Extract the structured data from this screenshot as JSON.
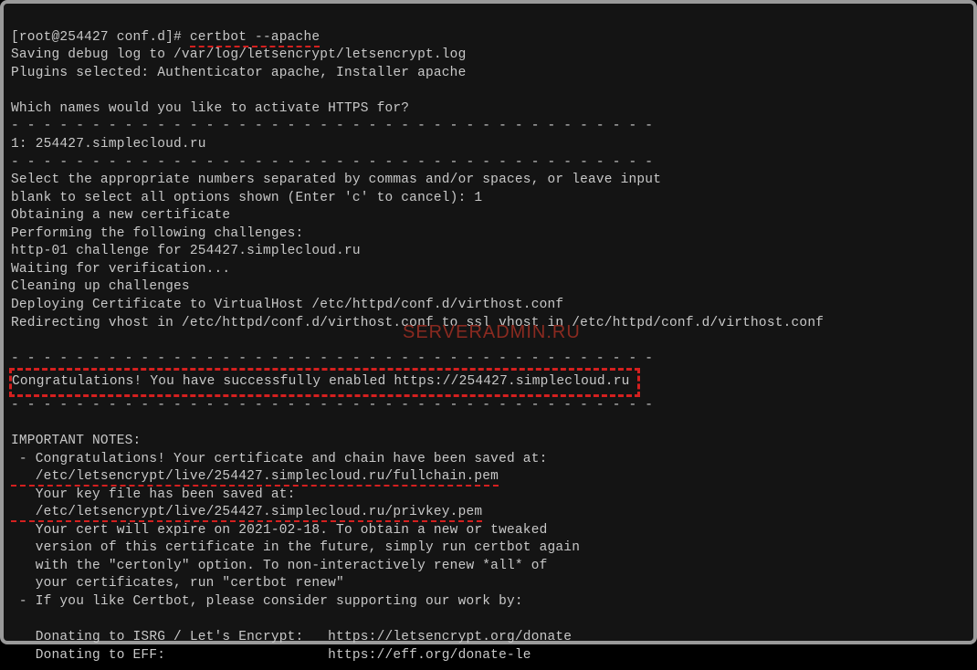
{
  "prompt": "[root@254427 conf.d]# ",
  "command": "certbot --apache",
  "lines": {
    "l1": "Saving debug log to /var/log/letsencrypt/letsencrypt.log",
    "l2": "Plugins selected: Authenticator apache, Installer apache",
    "l3": "",
    "l4": "Which names would you like to activate HTTPS for?",
    "l5": "- - - - - - - - - - - - - - - - - - - - - - - - - - - - - - - - - - - - - - - -",
    "l6": "1: 254427.simplecloud.ru",
    "l7": "- - - - - - - - - - - - - - - - - - - - - - - - - - - - - - - - - - - - - - - -",
    "l8": "Select the appropriate numbers separated by commas and/or spaces, or leave input",
    "l9": "blank to select all options shown (Enter 'c' to cancel): 1",
    "l10": "Obtaining a new certificate",
    "l11": "Performing the following challenges:",
    "l12": "http-01 challenge for 254427.simplecloud.ru",
    "l13": "Waiting for verification...",
    "l14": "Cleaning up challenges",
    "l15": "Deploying Certificate to VirtualHost /etc/httpd/conf.d/virthost.conf",
    "l16": "Redirecting vhost in /etc/httpd/conf.d/virthost.conf to ssl vhost in /etc/httpd/conf.d/virthost.conf",
    "l17": "",
    "l18": "- - - - - - - - - - - - - - - - - - - - - - - - - - - - - - - - - - - - - - - -",
    "congrats": "Congratulations! You have successfully enabled https://254427.simplecloud.ru",
    "l20": "- - - - - - - - - - - - - - - - - - - - - - - - - - - - - - - - - - - - - - - -",
    "l21": "",
    "l22": "IMPORTANT NOTES:",
    "l23": " - Congratulations! Your certificate and chain have been saved at:",
    "path1": "   /etc/letsencrypt/live/254427.simplecloud.ru/fullchain.pem",
    "l25": "   Your key file has been saved at:",
    "path2": "   /etc/letsencrypt/live/254427.simplecloud.ru/privkey.pem",
    "l27": "   Your cert will expire on 2021-02-18. To obtain a new or tweaked",
    "l28": "   version of this certificate in the future, simply run certbot again",
    "l29": "   with the \"certonly\" option. To non-interactively renew *all* of",
    "l30": "   your certificates, run \"certbot renew\"",
    "l31": " - If you like Certbot, please consider supporting our work by:",
    "l32": "",
    "l33": "   Donating to ISRG / Let's Encrypt:   https://letsencrypt.org/donate",
    "l34": "   Donating to EFF:                    https://eff.org/donate-le"
  },
  "watermark": "serveradmin.ru"
}
